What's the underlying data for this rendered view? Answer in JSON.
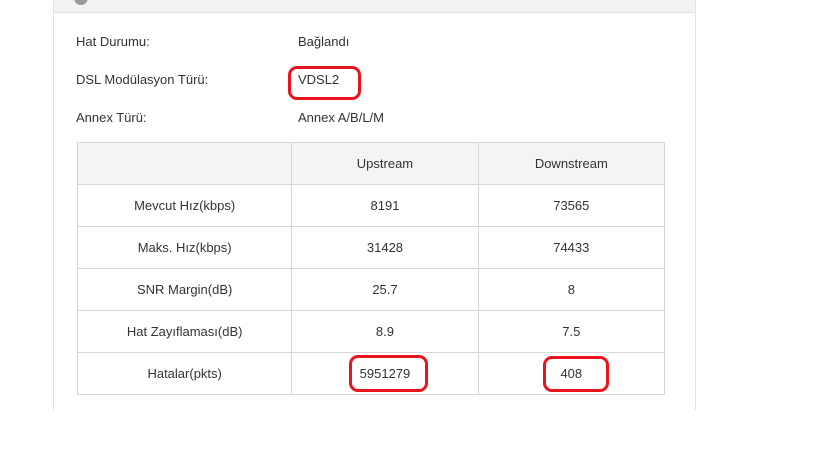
{
  "status": {
    "line_status_label": "Hat Durumu:",
    "line_status_value": "Bağlandı",
    "modulation_label": "DSL Modülasyon Türü:",
    "modulation_value": "VDSL2",
    "annex_label": "Annex Türü:",
    "annex_value": "Annex A/B/L/M"
  },
  "table": {
    "headers": [
      "",
      "Upstream",
      "Downstream"
    ],
    "rows": [
      {
        "label": "Mevcut Hız(kbps)",
        "upstream": "8191",
        "downstream": "73565"
      },
      {
        "label": "Maks. Hız(kbps)",
        "upstream": "31428",
        "downstream": "74433"
      },
      {
        "label": "SNR Margin(dB)",
        "upstream": "25.7",
        "downstream": "8"
      },
      {
        "label": "Hat Zayıflaması(dB)",
        "upstream": "8.9",
        "downstream": "7.5"
      },
      {
        "label": "Hatalar(pkts)",
        "upstream": "5951279",
        "downstream": "408"
      }
    ]
  },
  "annotation_color": "#e8141e"
}
